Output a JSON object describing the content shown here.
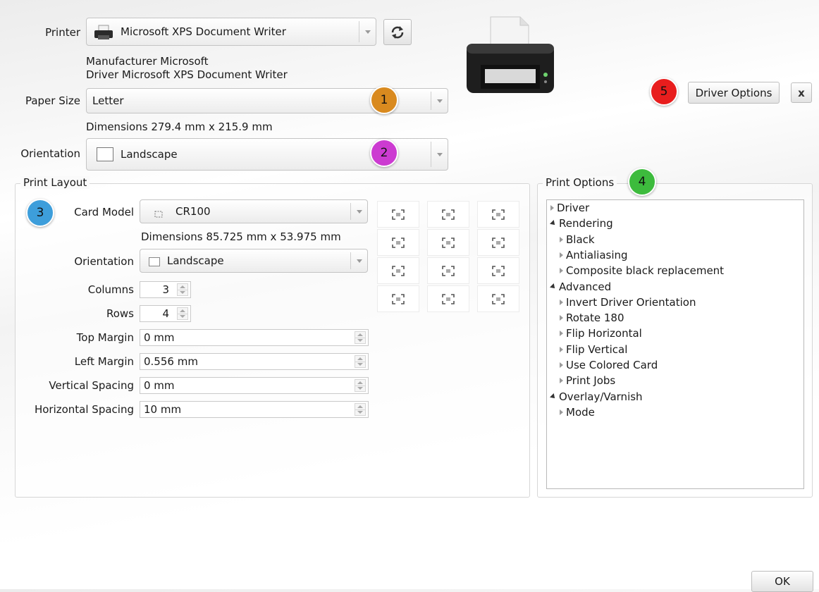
{
  "printer": {
    "label": "Printer",
    "value": "Microsoft XPS Document Writer",
    "manufacturer": "Manufacturer Microsoft",
    "driver": "Driver Microsoft XPS Document Writer"
  },
  "paper_size": {
    "label": "Paper Size",
    "value": "Letter",
    "dimensions": "Dimensions 279.4 mm x 215.9 mm"
  },
  "orientation": {
    "label": "Orientation",
    "value": "Landscape"
  },
  "buttons": {
    "driver_options": "Driver Options",
    "close": "x",
    "ok": "OK"
  },
  "badges": [
    {
      "number": "1",
      "color": "#d98a1f"
    },
    {
      "number": "2",
      "color": "#cc3bd1"
    },
    {
      "number": "3",
      "color": "#3d9edb"
    },
    {
      "number": "4",
      "color": "#3dbb3d"
    },
    {
      "number": "5",
      "color": "#e81d1d"
    }
  ],
  "print_layout": {
    "title": "Print Layout",
    "card_model_label": "Card Model",
    "card_model_value": "CR100",
    "dimensions": "Dimensions 85.725 mm x 53.975 mm",
    "orientation_label": "Orientation",
    "orientation_value": "Landscape",
    "columns_label": "Columns",
    "columns_value": "3",
    "rows_label": "Rows",
    "rows_value": "4",
    "top_margin_label": "Top Margin",
    "top_margin_value": "0 mm",
    "left_margin_label": "Left Margin",
    "left_margin_value": "0.556 mm",
    "vertical_spacing_label": "Vertical Spacing",
    "vertical_spacing_value": "0 mm",
    "horizontal_spacing_label": "Horizontal Spacing",
    "horizontal_spacing_value": "10 mm"
  },
  "print_options": {
    "title": "Print Options",
    "tree": [
      {
        "label": "Driver",
        "level": 0,
        "expanded": false
      },
      {
        "label": "Rendering",
        "level": 0,
        "expanded": true
      },
      {
        "label": "Black",
        "level": 1,
        "expanded": false
      },
      {
        "label": "Antialiasing",
        "level": 1,
        "expanded": false
      },
      {
        "label": "Composite black replacement",
        "level": 1,
        "expanded": false
      },
      {
        "label": "Advanced",
        "level": 0,
        "expanded": true
      },
      {
        "label": "Invert Driver Orientation",
        "level": 1,
        "expanded": false
      },
      {
        "label": "Rotate 180",
        "level": 1,
        "expanded": false
      },
      {
        "label": "Flip Horizontal",
        "level": 1,
        "expanded": false
      },
      {
        "label": "Flip Vertical",
        "level": 1,
        "expanded": false
      },
      {
        "label": "Use Colored Card",
        "level": 1,
        "expanded": false
      },
      {
        "label": "Print Jobs",
        "level": 1,
        "expanded": false
      },
      {
        "label": "Overlay/Varnish",
        "level": 0,
        "expanded": true
      },
      {
        "label": "Mode",
        "level": 1,
        "expanded": false
      }
    ]
  },
  "icons": [
    "printer-icon",
    "refresh-icon",
    "printer-illustration-icon",
    "card-icon",
    "page-icon"
  ]
}
